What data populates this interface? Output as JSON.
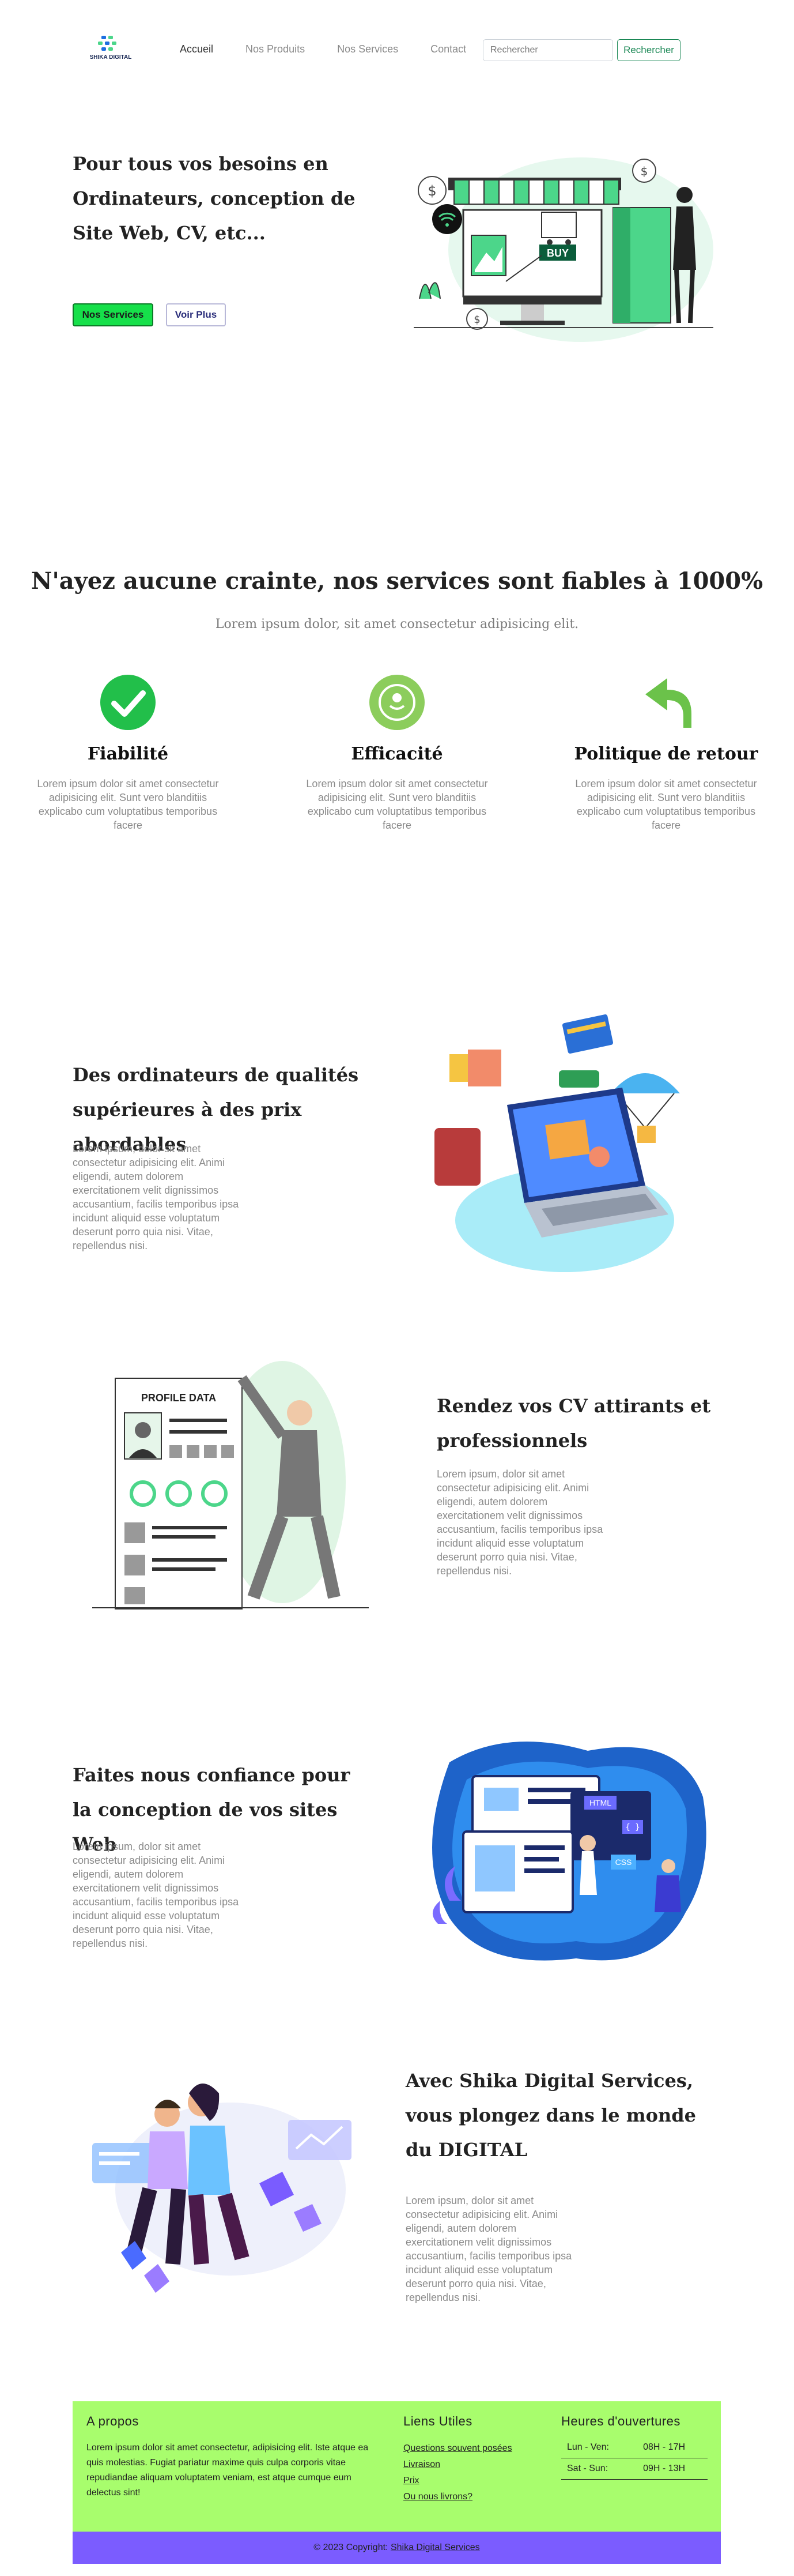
{
  "nav": {
    "logo_text": "SHIKA DIGITAL",
    "links": [
      "Accueil",
      "Nos Produits",
      "Nos Services",
      "Contact"
    ],
    "search_placeholder": "Rechercher",
    "search_button": "Rechercher"
  },
  "hero": {
    "title": "Pour tous vos besoins en Ordinateurs, conception de Site Web, CV, etc...",
    "btn_services": "Nos Services",
    "btn_more": "Voir Plus",
    "illustration_sign": "BUY"
  },
  "assurance": {
    "title": "N'ayez aucune crainte, nos services sont fiables à 1000%",
    "subtitle": "Lorem ipsum dolor, sit amet consectetur adipisicing elit.",
    "features": [
      {
        "title": "Fiabilité",
        "text": "Lorem ipsum dolor sit amet consectetur adipisicing elit. Sunt vero blanditiis explicabo cum voluptatibus temporibus facere",
        "icon": "checkmark-icon"
      },
      {
        "title": "Efficacité",
        "text": "Lorem ipsum dolor sit amet consectetur adipisicing elit. Sunt vero blanditiis explicabo cum voluptatibus temporibus facere",
        "icon": "efficiency-icon"
      },
      {
        "title": "Politique de retour",
        "text": "Lorem ipsum dolor sit amet consectetur adipisicing elit. Sunt vero blanditiis explicabo cum voluptatibus temporibus facere",
        "icon": "return-arrow-icon"
      }
    ]
  },
  "sections": [
    {
      "title": "Des ordinateurs de qualités supérieures à des prix abordables",
      "text": "Lorem ipsum, dolor sit amet consectetur adipisicing elit. Animi eligendi, autem dolorem exercitationem velit dignissimos accusantium, facilis temporibus ipsa incidunt aliquid esse voluptatum deserunt porro quia nisi. Vitae, repellendus nisi."
    },
    {
      "title": "Rendez vos CV attirants et professionnels",
      "text": "Lorem ipsum, dolor sit amet consectetur adipisicing elit. Animi eligendi, autem dolorem exercitationem velit dignissimos accusantium, facilis temporibus ipsa incidunt aliquid esse voluptatum deserunt porro quia nisi. Vitae, repellendus nisi.",
      "illustration_label": "PROFILE DATA"
    },
    {
      "title": "Faites nous confiance pour la conception de vos sites Web",
      "text": "Lorem ipsum, dolor sit amet consectetur adipisicing elit. Animi eligendi, autem dolorem exercitationem velit dignissimos accusantium, facilis temporibus ipsa incidunt aliquid esse voluptatum deserunt porro quia nisi. Vitae, repellendus nisi.",
      "illustration_labels": [
        "HTML",
        "CSS",
        "{ }"
      ]
    },
    {
      "title": "Avec Shika Digital Services, vous plongez dans le monde du DIGITAL",
      "text": "Lorem ipsum, dolor sit amet consectetur adipisicing elit. Animi eligendi, autem dolorem exercitationem velit dignissimos accusantium, facilis temporibus ipsa incidunt aliquid esse voluptatum deserunt porro quia nisi. Vitae, repellendus nisi."
    }
  ],
  "footer": {
    "about_title": "A propos",
    "about_text": "Lorem ipsum dolor sit amet consectetur, adipisicing elit. Iste atque ea quis molestias. Fugiat pariatur maxime quis culpa corporis vitae repudiandae aliquam voluptatem veniam, est atque cumque eum delectus sint!",
    "links_title": "Liens Utiles",
    "links": [
      "Questions souvent posées",
      "Livraison",
      "Prix",
      "Ou nous livrons?"
    ],
    "hours_title": "Heures d'ouvertures",
    "hours": [
      [
        "Lun - Ven:",
        "08H - 17H"
      ],
      [
        "Sat - Sun:",
        "09H - 13H"
      ]
    ],
    "copyright_prefix": "© 2023 Copyright:",
    "copyright_link": "Shika Digital Services"
  },
  "colors": {
    "footer_bg": "#a8fd6d",
    "copyright_bg": "#7b5cff",
    "primary_button": "#16e04a",
    "accent_green": "#4cd68a",
    "accent_blue": "#1d6fe0"
  }
}
